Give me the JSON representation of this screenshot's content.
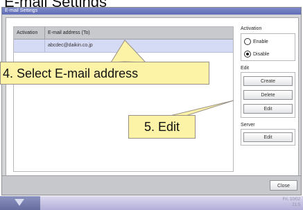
{
  "page": {
    "title": "E-mail Settings"
  },
  "window": {
    "title": "E-mail Settings"
  },
  "table": {
    "columns": [
      "Activation",
      "E-mail address (To)"
    ],
    "rows": [
      {
        "activation": "",
        "email": "abcdec@daikin.co.jp"
      }
    ]
  },
  "activation": {
    "label": "Activation",
    "options": [
      {
        "label": "Enable",
        "checked": false
      },
      {
        "label": "Disable",
        "checked": true
      }
    ]
  },
  "edit": {
    "label": "Edit",
    "create_label": "Create",
    "delete_label": "Delete",
    "edit_label": "Edit"
  },
  "server": {
    "label": "Server",
    "edit_label": "Edit"
  },
  "footer": {
    "close_label": "Close"
  },
  "taskbar": {
    "date": "Fri, 10/02",
    "time": "21:5"
  },
  "callouts": {
    "select": "4. Select E-mail address",
    "edit": "5. Edit"
  },
  "colors": {
    "titlebar": "#6c77ba",
    "selected_row": "#d6dbf5",
    "callout_fill": "#fcf3a6"
  }
}
